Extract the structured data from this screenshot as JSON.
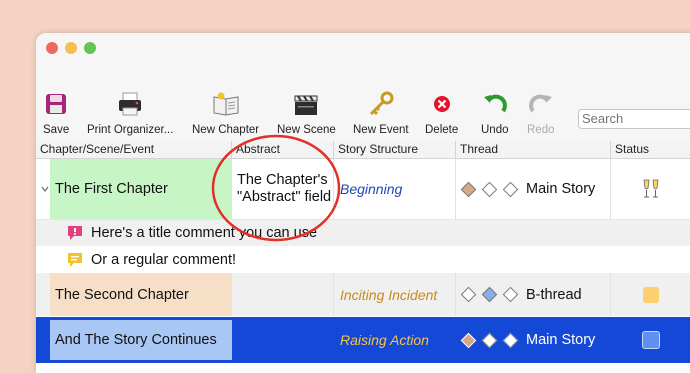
{
  "toolbar": {
    "save": "Save",
    "print": "Print Organizer...",
    "new_chapter": "New Chapter",
    "new_scene": "New Scene",
    "new_event": "New Event",
    "delete": "Delete",
    "undo": "Undo",
    "redo": "Redo"
  },
  "search": {
    "placeholder": "Search"
  },
  "columns": {
    "chapter": "Chapter/Scene/Event",
    "abstract": "Abstract",
    "structure": "Story Structure",
    "thread": "Thread",
    "status": "Status"
  },
  "rows": [
    {
      "title": "The First Chapter",
      "abstract": "The Chapter's \"Abstract\" field",
      "structure": "Beginning",
      "thread": "Main Story",
      "status_icon": "champagne-icon"
    },
    {
      "comment": "Here's a title comment you can use",
      "icon": "pink-comment-icon"
    },
    {
      "comment": "Or a regular comment!",
      "icon": "yellow-comment-icon"
    },
    {
      "title": "The Second Chapter",
      "abstract": "",
      "structure": "Inciting Incident",
      "thread": "B-thread",
      "status_color": "#fcd06e"
    },
    {
      "title": "And The Story Continues",
      "abstract": "",
      "structure": "Raising Action",
      "thread": "Main Story",
      "status_color": "#5f8ff2"
    }
  ],
  "colors": {
    "row1_title_bg": "#c8f5c6",
    "row4_title_bg": "#f6dfc6",
    "selection": "#1448d6",
    "annotation_circle": "#e03028",
    "structure_blue": "#2246b8",
    "structure_gold": "#c68a1a",
    "structure_selected": "#f6c544"
  }
}
